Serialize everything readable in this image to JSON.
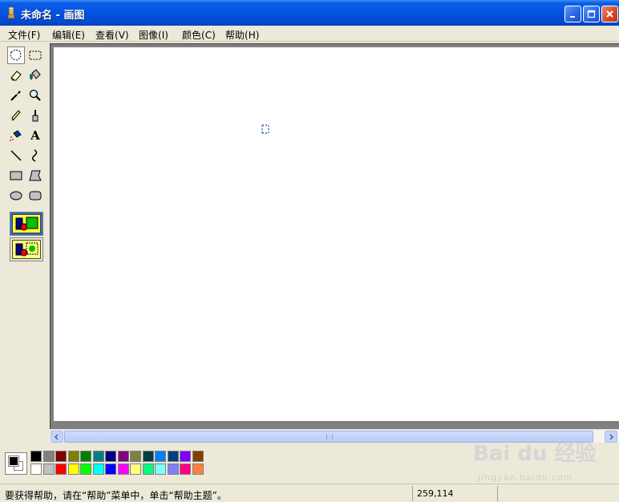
{
  "window": {
    "title": "未命名 - 画图",
    "minimize_label": "_",
    "maximize_label": "□",
    "close_label": "×"
  },
  "menu": {
    "items": [
      {
        "label": "文件",
        "key": "(F)"
      },
      {
        "label": "编辑",
        "key": "(E)"
      },
      {
        "label": "查看",
        "key": "(V)"
      },
      {
        "label": "图像",
        "key": "(I)"
      },
      {
        "label": "颜色",
        "key": "(C)"
      },
      {
        "label": "帮助",
        "key": "(H)"
      }
    ]
  },
  "tools": [
    {
      "name": "free-form-select",
      "icon": "free-select-icon",
      "active": true
    },
    {
      "name": "rect-select",
      "icon": "rect-select-icon"
    },
    {
      "name": "eraser",
      "icon": "eraser-icon"
    },
    {
      "name": "fill",
      "icon": "fill-bucket-icon"
    },
    {
      "name": "pick-color",
      "icon": "eyedropper-icon"
    },
    {
      "name": "magnifier",
      "icon": "magnifier-icon"
    },
    {
      "name": "pencil",
      "icon": "pencil-icon"
    },
    {
      "name": "brush",
      "icon": "brush-icon"
    },
    {
      "name": "airbrush",
      "icon": "airbrush-icon"
    },
    {
      "name": "text",
      "icon": "text-icon",
      "glyph": "A"
    },
    {
      "name": "line",
      "icon": "line-icon"
    },
    {
      "name": "curve",
      "icon": "curve-icon"
    },
    {
      "name": "rectangle",
      "icon": "rectangle-icon"
    },
    {
      "name": "polygon",
      "icon": "polygon-icon"
    },
    {
      "name": "ellipse",
      "icon": "ellipse-icon"
    },
    {
      "name": "rounded-rectangle",
      "icon": "rounded-rect-icon"
    }
  ],
  "palette": {
    "foreground": "#000000",
    "background": "#ffffff",
    "top_row": [
      "#000000",
      "#808080",
      "#800000",
      "#808000",
      "#008000",
      "#008080",
      "#000080",
      "#800080",
      "#808040",
      "#004040",
      "#0080ff",
      "#004080",
      "#8000ff",
      "#804000"
    ],
    "bottom_row": [
      "#ffffff",
      "#c0c0c0",
      "#ff0000",
      "#ffff00",
      "#00ff00",
      "#00ffff",
      "#0000ff",
      "#ff00ff",
      "#ffff80",
      "#00ff80",
      "#80ffff",
      "#8080ff",
      "#ff0080",
      "#ff8040"
    ]
  },
  "status": {
    "help_text": "要获得帮助，请在“帮助”菜单中，单击“帮助主题”。",
    "coords": "259,114"
  },
  "watermark": {
    "text": "Bai du 经验",
    "sub": "jingyan.baidu.com"
  },
  "colors": {
    "title_bar": "#0553e0",
    "face": "#ece9d8",
    "canvas": "#ffffff",
    "workspace": "#808080"
  }
}
